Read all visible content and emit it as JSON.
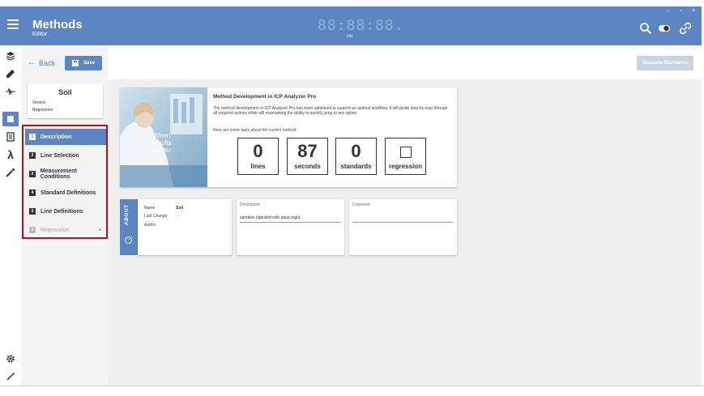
{
  "header": {
    "title": "Methods",
    "subtitle": "Editor",
    "clock": "88:88:88.",
    "clock_state": "idle",
    "window_controls": [
      "–",
      "▫",
      "×"
    ],
    "icons": [
      "search-icon",
      "toggle-icon",
      "link-icon"
    ]
  },
  "rail": {
    "items": [
      "layers-icon",
      "flask-icon",
      "spectrum-icon",
      "document-icon",
      "list-icon",
      "lambda-icon",
      "wand-icon"
    ],
    "bottom": [
      "gear-icon",
      "brush-icon"
    ],
    "active_index": 3
  },
  "toolbar": {
    "back_label": "Back",
    "save_label": "Save",
    "measure_label": "Measure Standards"
  },
  "method": {
    "name": "Soil",
    "line1": "Version",
    "line2": "Regression"
  },
  "steps": [
    {
      "num": "1",
      "label": "Description",
      "state": "active"
    },
    {
      "num": "2",
      "label": "Line Selection",
      "state": "normal"
    },
    {
      "num": "3",
      "label": "Measurement Conditions",
      "state": "normal"
    },
    {
      "num": "4",
      "label": "Standard Definitions",
      "state": "normal"
    },
    {
      "num": "5",
      "label": "Line Definitions",
      "state": "normal"
    },
    {
      "num": "6",
      "label": "Regression",
      "state": "disabled"
    }
  ],
  "info": {
    "photo_text": [
      "When",
      "results",
      "matter"
    ],
    "title": "Method Development in ICP Analyzer Pro",
    "body": "The method development in ICP Analyzer Pro has been optimized to support an optimal workflow. It will guide step-by-step through all required actions while still maintaining the ability to quickly jump to any option",
    "facts": "Here are some facts about the current method:",
    "stats": [
      {
        "value": "0",
        "label": "lines"
      },
      {
        "value": "87",
        "label": "seconds"
      },
      {
        "value": "0",
        "label": "standards"
      },
      {
        "value": "",
        "label": "regression"
      }
    ]
  },
  "about": {
    "tab_label": "ABOUT",
    "name_label": "Name",
    "name_value": "Soil",
    "last_change_label": "Last Change",
    "last_change_value": "-  -",
    "author_label": "Author",
    "description_label": "Description",
    "description_value": "samples digested with aqua regia",
    "comment_label": "Comment",
    "comment_value": ""
  },
  "colors": {
    "accent": "#5b86c1",
    "highlight_border": "#b3121b"
  }
}
